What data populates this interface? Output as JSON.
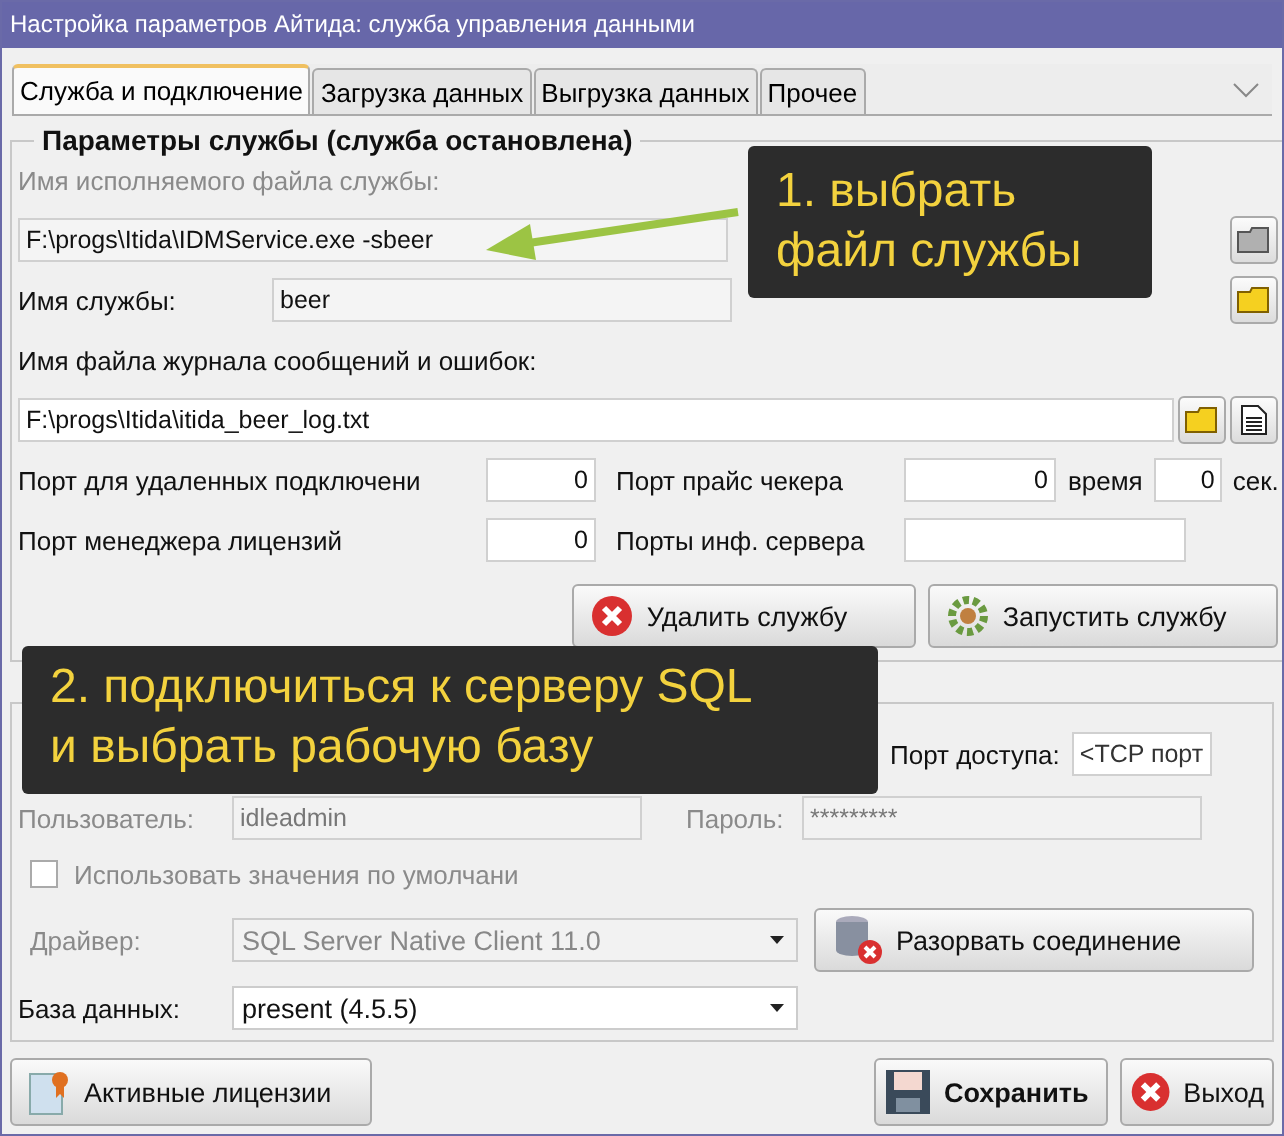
{
  "window": {
    "title": "Настройка параметров Айтида: служба управления данными"
  },
  "tabs": [
    {
      "label": "Служба и подключение",
      "selected": true
    },
    {
      "label": "Загрузка данных",
      "selected": false
    },
    {
      "label": "Выгрузка данных",
      "selected": false
    },
    {
      "label": "Прочее",
      "selected": false
    }
  ],
  "service": {
    "title": "Параметры службы (служба остановлена)",
    "exe_label": "Имя исполняемого файла службы:",
    "exe_label_disabled": true,
    "exe_value": "F:\\progs\\Itida\\IDMService.exe -sbeer",
    "name_label": "Имя службы:",
    "name_value": "beer",
    "log_label": "Имя файла журнала сообщений и ошибок:",
    "log_value": "F:\\progs\\Itida\\itida_beer_log.txt",
    "remote_port_label": "Порт для удаленных подключени",
    "remote_port": "0",
    "checker_port_label": "Порт прайс чекера",
    "checker_port": "0",
    "time_label": "время",
    "time_value": "0",
    "sec_label": "сек.",
    "license_port_label": "Порт менеджера лицензий",
    "license_port": "0",
    "info_ports_label": "Порты инф. сервера",
    "buttons": [
      {
        "kind": "delete",
        "label": "Удалить службу"
      },
      {
        "kind": "start",
        "label": "Запустить службу"
      }
    ]
  },
  "connection": {
    "access_port_label": "Порт доступа:",
    "access_port_placeholder": "<TCP порт",
    "user_label": "Пользователь:",
    "user_value": "idleadmin",
    "password_label": "Пароль:",
    "password_value": "*********",
    "defaults": {
      "label": "Использовать значения по умолчани",
      "checked": false
    },
    "driver_label": "Драйвер:",
    "driver_value": "SQL Server Native Client 11.0",
    "driver_disabled": true,
    "disconnect_label": "Разорвать соединение",
    "db_label": "База данных:",
    "db_value": "present (4.5.5)"
  },
  "footer": {
    "licenses": "Активные лицензии",
    "save": "Сохранить",
    "exit": "Выход"
  },
  "callouts": [
    {
      "text": "1. выбрать\nфайл службы"
    },
    {
      "text": "2. подключиться к серверу SQL\nи выбрать рабочую базу"
    }
  ]
}
